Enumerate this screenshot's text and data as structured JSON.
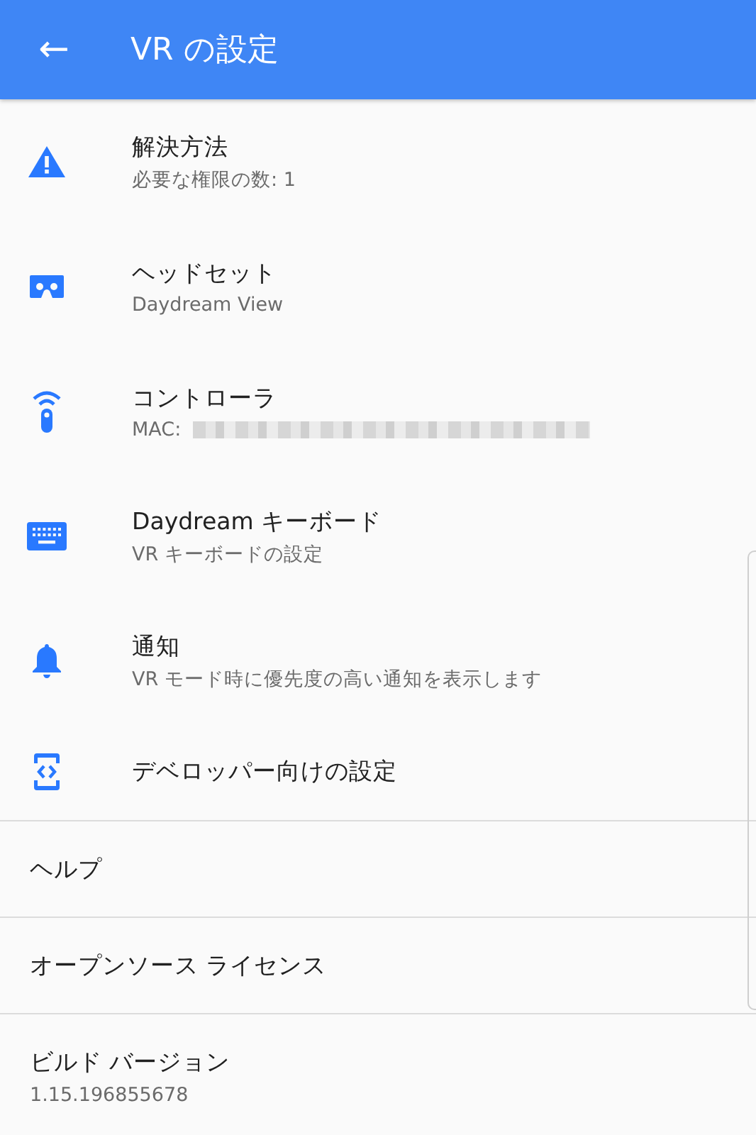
{
  "app_bar": {
    "back": "←",
    "title": "VR の設定"
  },
  "icon_items": [
    {
      "title": "解決方法",
      "subtitle": "必要な権限の数: 1",
      "redacted": false
    },
    {
      "title": "ヘッドセット",
      "subtitle": "Daydream View",
      "redacted": false
    },
    {
      "title": "コントローラ",
      "subtitle": "MAC:",
      "redacted": true
    },
    {
      "title": "Daydream キーボード",
      "subtitle": "VR キーボードの設定",
      "redacted": false
    },
    {
      "title": "通知",
      "subtitle": "VR モード時に優先度の高い通知を表示します",
      "redacted": false
    },
    {
      "title": "デベロッパー向けの設定",
      "redacted": false
    }
  ],
  "plain_items": [
    {
      "title": "ヘルプ"
    },
    {
      "title": "オープンソース ライセンス"
    },
    {
      "title": "ビルド バージョン",
      "subtitle": "1.15.196855678"
    }
  ]
}
